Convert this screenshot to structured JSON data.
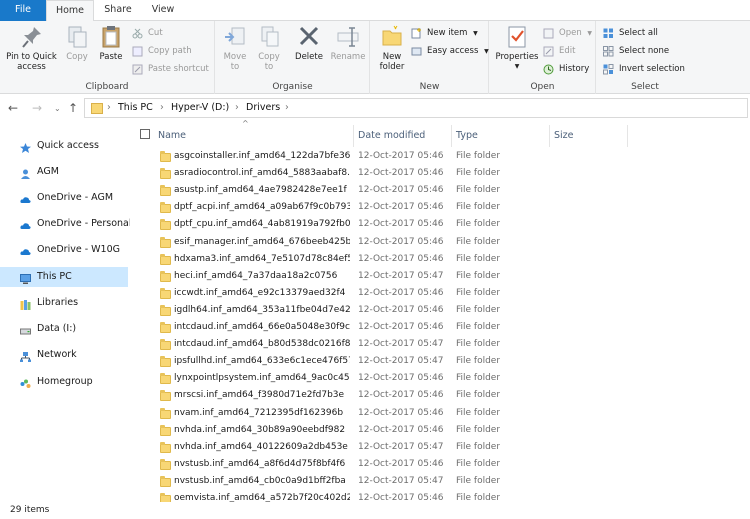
{
  "tabs": {
    "file": "File",
    "home": "Home",
    "share": "Share",
    "view": "View"
  },
  "ribbon": {
    "clipboard": {
      "label": "Clipboard",
      "pin": "Pin to Quick\naccess",
      "pin_line1": "Pin to Quick",
      "pin_line2": "access",
      "copy": "Copy",
      "paste": "Paste",
      "cut": "Cut",
      "copy_path": "Copy path",
      "paste_shortcut": "Paste shortcut"
    },
    "organise": {
      "label": "Organise",
      "move_to_line1": "Move",
      "move_to_line2": "to",
      "copy_to_line1": "Copy",
      "copy_to_line2": "to",
      "delete": "Delete",
      "rename": "Rename"
    },
    "new": {
      "label": "New",
      "new_folder_line1": "New",
      "new_folder_line2": "folder",
      "new_item": "New item",
      "easy_access": "Easy access"
    },
    "open": {
      "label": "Open",
      "properties": "Properties",
      "open": "Open",
      "edit": "Edit",
      "history": "History"
    },
    "select": {
      "label": "Select",
      "select_all": "Select all",
      "select_none": "Select none",
      "invert": "Invert selection"
    }
  },
  "address": {
    "crumbs": [
      "This PC",
      "Hyper-V (D:)",
      "Drivers"
    ]
  },
  "nav": {
    "items": [
      {
        "label": "Quick access",
        "icon": "star-icon"
      },
      {
        "label": "AGM",
        "icon": "user-folder-icon"
      },
      {
        "label": "OneDrive - AGM",
        "icon": "cloud-icon"
      },
      {
        "label": "OneDrive - Personal",
        "icon": "cloud-icon"
      },
      {
        "label": "OneDrive - W10G",
        "icon": "cloud-icon"
      },
      {
        "label": "This PC",
        "icon": "computer-icon"
      },
      {
        "label": "Libraries",
        "icon": "library-icon"
      },
      {
        "label": "Data (I:)",
        "icon": "drive-icon"
      },
      {
        "label": "Network",
        "icon": "network-icon"
      },
      {
        "label": "Homegroup",
        "icon": "homegroup-icon"
      }
    ]
  },
  "columns": {
    "name": "Name",
    "date": "Date modified",
    "type": "Type",
    "size": "Size"
  },
  "files": [
    {
      "name": "asgcoinstaller.inf_amd64_122da7bfe36...",
      "date": "12-Oct-2017 05:46",
      "type": "File folder"
    },
    {
      "name": "asradiocontrol.inf_amd64_5883aabaf8...",
      "date": "12-Oct-2017 05:46",
      "type": "File folder"
    },
    {
      "name": "asustp.inf_amd64_4ae7982428e7ee1f",
      "date": "12-Oct-2017 05:46",
      "type": "File folder"
    },
    {
      "name": "dptf_acpi.inf_amd64_a09ab67f9c0b7934",
      "date": "12-Oct-2017 05:46",
      "type": "File folder"
    },
    {
      "name": "dptf_cpu.inf_amd64_4ab81919a792fb0c",
      "date": "12-Oct-2017 05:46",
      "type": "File folder"
    },
    {
      "name": "esif_manager.inf_amd64_676beeb425b...",
      "date": "12-Oct-2017 05:46",
      "type": "File folder"
    },
    {
      "name": "hdxama3.inf_amd64_7e5107d78c84ef59",
      "date": "12-Oct-2017 05:46",
      "type": "File folder"
    },
    {
      "name": "heci.inf_amd64_7a37daa18a2c0756",
      "date": "12-Oct-2017 05:47",
      "type": "File folder"
    },
    {
      "name": "iccwdt.inf_amd64_e92c13379aed32f4",
      "date": "12-Oct-2017 05:46",
      "type": "File folder"
    },
    {
      "name": "igdlh64.inf_amd64_353a11fbe04d7e42",
      "date": "12-Oct-2017 05:46",
      "type": "File folder"
    },
    {
      "name": "intcdaud.inf_amd64_66e0a5048e30f9c5",
      "date": "12-Oct-2017 05:46",
      "type": "File folder"
    },
    {
      "name": "intcdaud.inf_amd64_b80d538dc0216f86",
      "date": "12-Oct-2017 05:47",
      "type": "File folder"
    },
    {
      "name": "ipsfullhd.inf_amd64_633e6c1ece476f57",
      "date": "12-Oct-2017 05:47",
      "type": "File folder"
    },
    {
      "name": "lynxpointlpsystem.inf_amd64_9ac0c45...",
      "date": "12-Oct-2017 05:46",
      "type": "File folder"
    },
    {
      "name": "mrscsi.inf_amd64_f3980d71e2fd7b3e",
      "date": "12-Oct-2017 05:46",
      "type": "File folder"
    },
    {
      "name": "nvam.inf_amd64_7212395df162396b",
      "date": "12-Oct-2017 05:46",
      "type": "File folder"
    },
    {
      "name": "nvhda.inf_amd64_30b89a90eebdf982",
      "date": "12-Oct-2017 05:46",
      "type": "File folder"
    },
    {
      "name": "nvhda.inf_amd64_40122609a2db453e",
      "date": "12-Oct-2017 05:47",
      "type": "File folder"
    },
    {
      "name": "nvstusb.inf_amd64_a8f6d4d75f8bf4f6",
      "date": "12-Oct-2017 05:46",
      "type": "File folder"
    },
    {
      "name": "nvstusb.inf_amd64_cb0c0a9d1bff2fba",
      "date": "12-Oct-2017 05:47",
      "type": "File folder"
    },
    {
      "name": "oemvista.inf_amd64_a572b7f20c402d28",
      "date": "12-Oct-2017 05:46",
      "type": "File folder"
    }
  ],
  "status": {
    "count": "29 items"
  }
}
